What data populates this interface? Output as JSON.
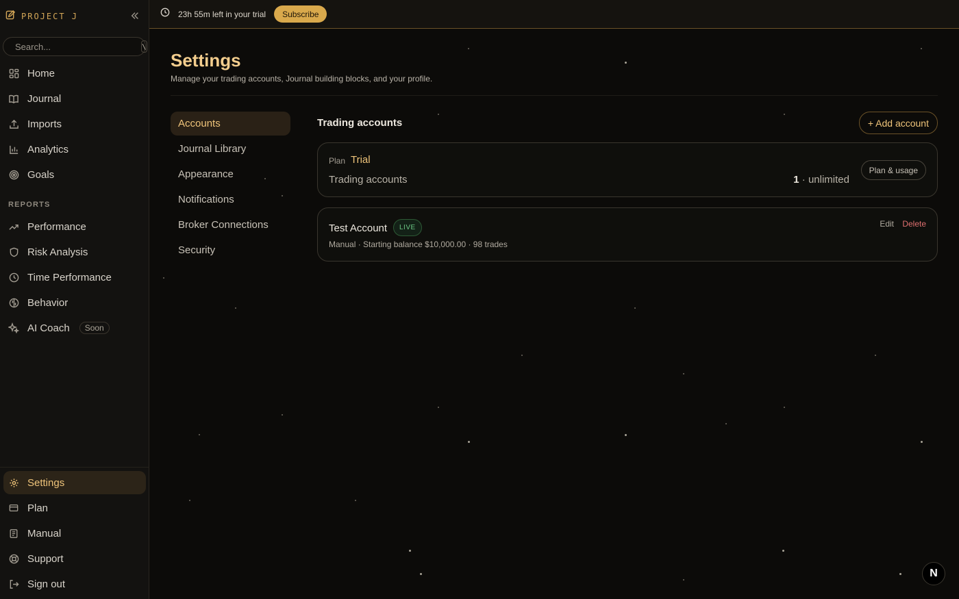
{
  "brand": {
    "name": "PROJECT J"
  },
  "search": {
    "placeholder": "Search...",
    "shortcut": "\\"
  },
  "sidebar": {
    "main_items": [
      {
        "label": "Home",
        "icon": "grid-icon"
      },
      {
        "label": "Journal",
        "icon": "book-icon"
      },
      {
        "label": "Imports",
        "icon": "upload-icon"
      },
      {
        "label": "Analytics",
        "icon": "bar-chart-icon"
      },
      {
        "label": "Goals",
        "icon": "target-icon"
      }
    ],
    "reports_label": "REPORTS",
    "report_items": [
      {
        "label": "Performance",
        "icon": "trending-up-icon"
      },
      {
        "label": "Risk Analysis",
        "icon": "shield-icon"
      },
      {
        "label": "Time Performance",
        "icon": "clock-icon"
      },
      {
        "label": "Behavior",
        "icon": "brain-icon"
      },
      {
        "label": "AI Coach",
        "icon": "sparkles-icon",
        "badge": "Soon"
      }
    ],
    "bottom_items": [
      {
        "label": "Settings",
        "icon": "gear-icon",
        "active": true
      },
      {
        "label": "Plan",
        "icon": "credit-card-icon"
      },
      {
        "label": "Manual",
        "icon": "manual-icon"
      },
      {
        "label": "Support",
        "icon": "lifebuoy-icon"
      },
      {
        "label": "Sign out",
        "icon": "sign-out-icon"
      }
    ]
  },
  "topbar": {
    "trial_text": "23h 55m left in your trial",
    "subscribe_label": "Subscribe"
  },
  "page": {
    "title": "Settings",
    "subtitle": "Manage your trading accounts, Journal building blocks, and your profile."
  },
  "settings_nav": [
    {
      "label": "Accounts",
      "active": true
    },
    {
      "label": "Journal Library"
    },
    {
      "label": "Appearance"
    },
    {
      "label": "Notifications"
    },
    {
      "label": "Broker Connections"
    },
    {
      "label": "Security"
    }
  ],
  "accounts": {
    "title": "Trading accounts",
    "add_label": "+ Add account",
    "plan": {
      "label": "Plan",
      "value": "Trial",
      "row_label": "Trading accounts",
      "count": "1",
      "limit": "· unlimited",
      "button_label": "Plan & usage"
    },
    "items": [
      {
        "name": "Test Account",
        "badge": "LIVE",
        "meta": "Manual · Starting balance $10,000.00 · 98 trades",
        "edit_label": "Edit",
        "delete_label": "Delete"
      }
    ]
  },
  "corner_badge": "N",
  "colors": {
    "accent": "#efc47a",
    "subscribe": "#d9a94c",
    "live": "#6cc784",
    "danger": "#e07070"
  }
}
